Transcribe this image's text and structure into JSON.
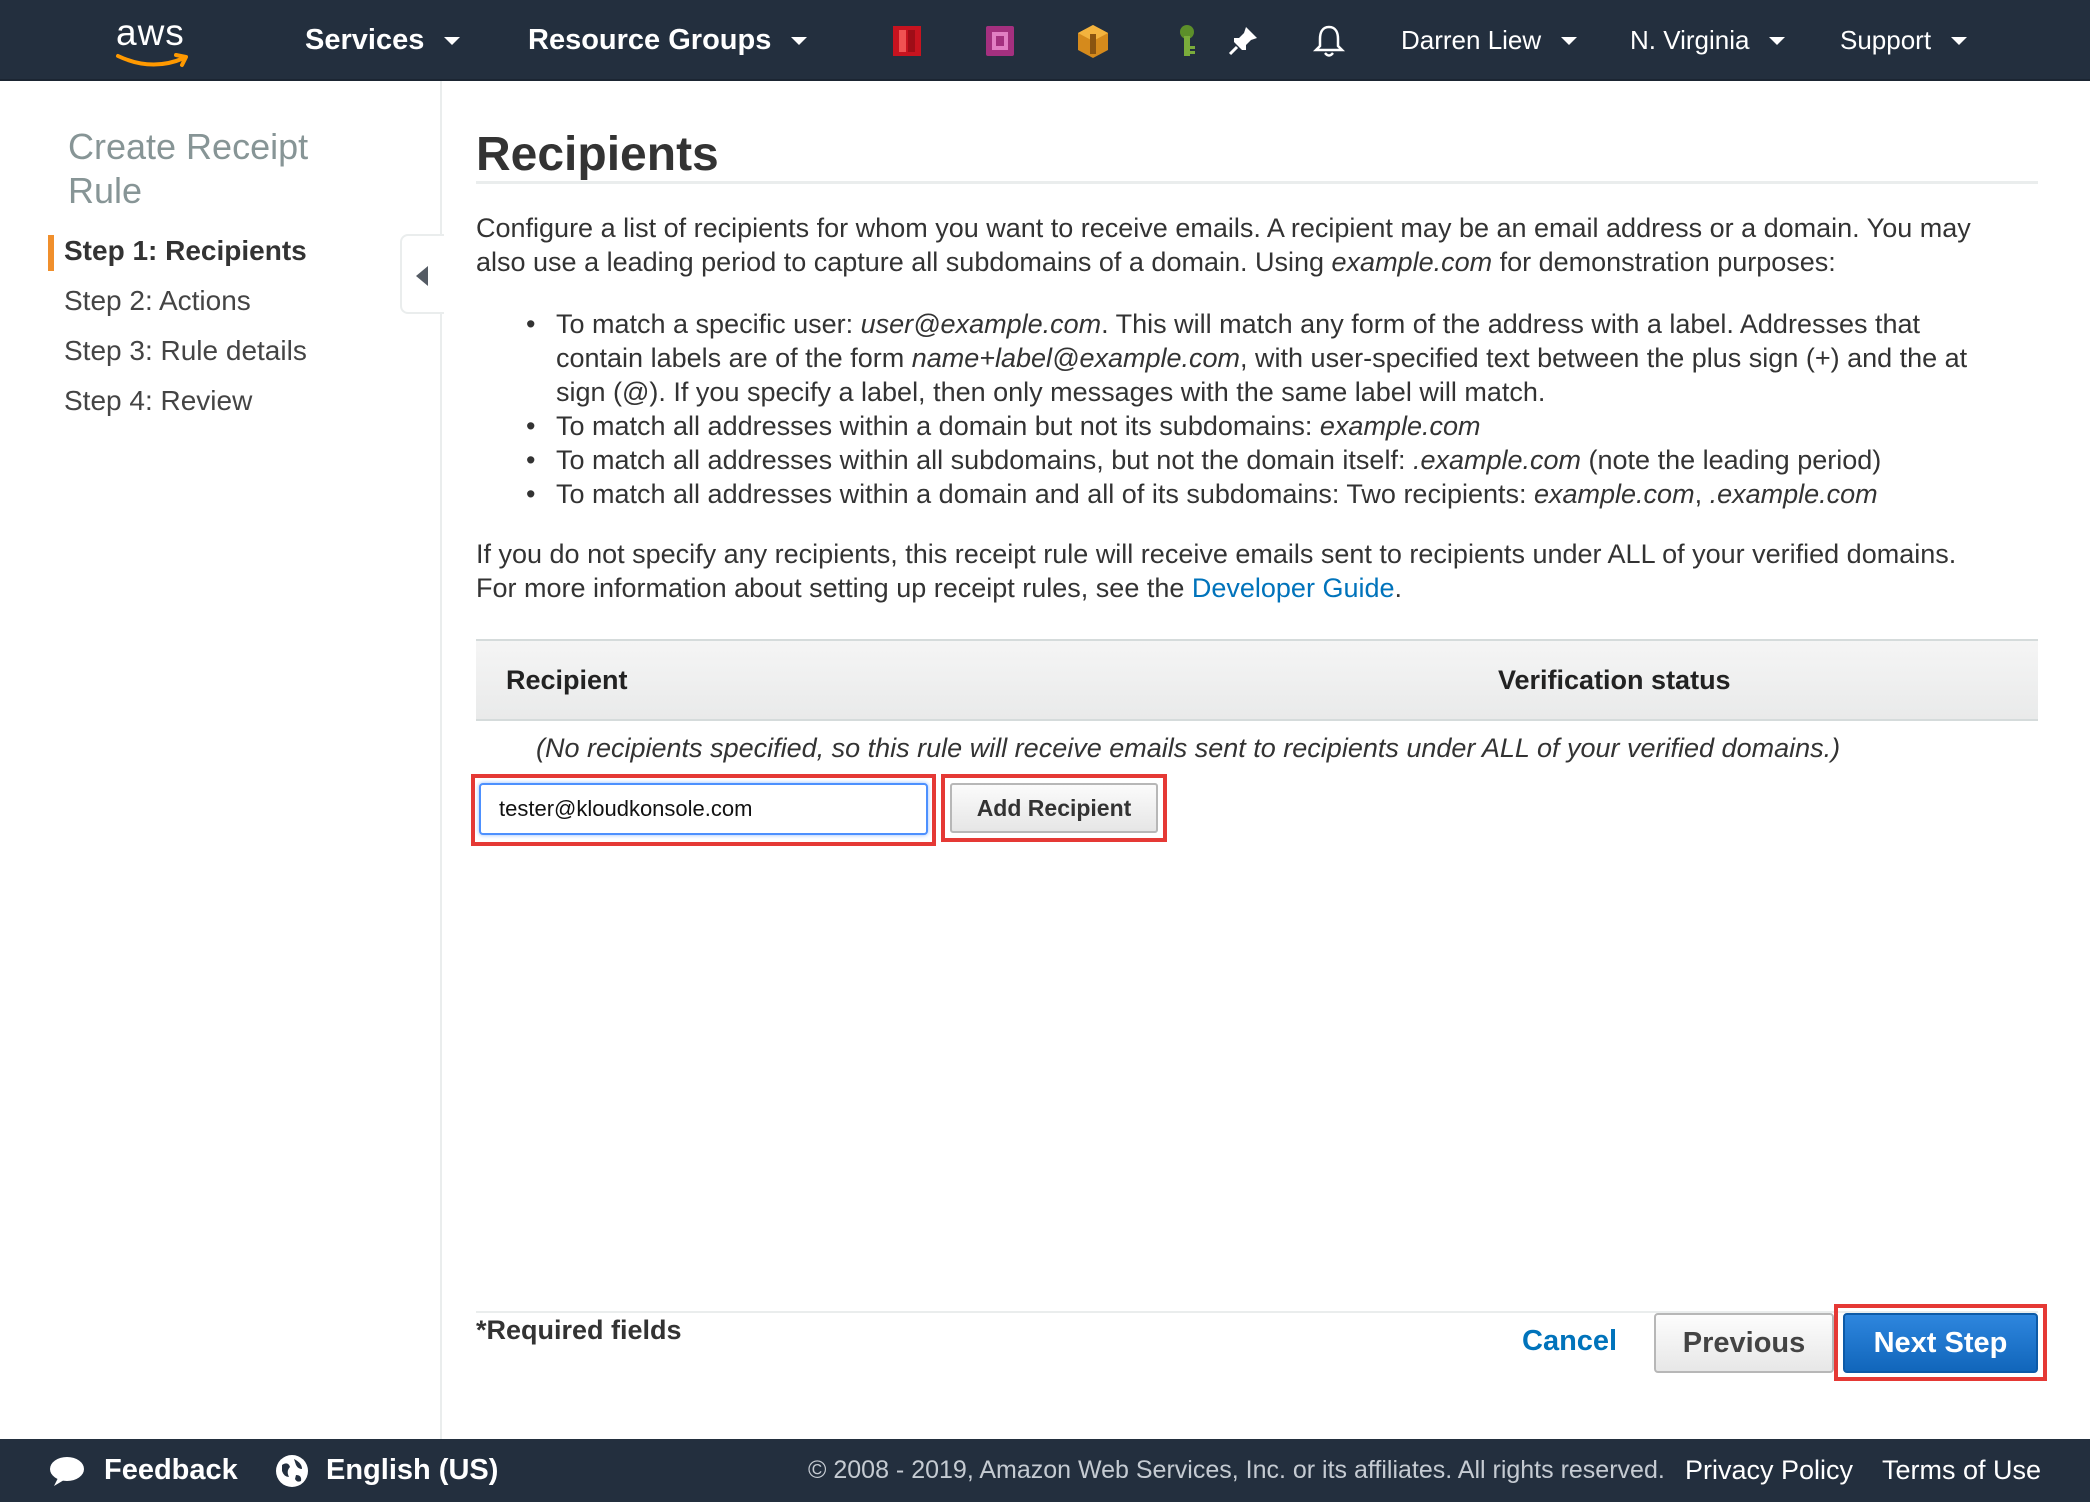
{
  "topnav": {
    "logo_text": "aws",
    "services_label": "Services",
    "resource_groups_label": "Resource Groups",
    "user_label": "Darren Liew",
    "region_label": "N. Virginia",
    "support_label": "Support",
    "service_icons": [
      "red-service-icon",
      "purple-service-icon",
      "orange-service-icon",
      "green-key-icon"
    ],
    "pin_icon": "pin-icon",
    "bell_icon": "bell-icon"
  },
  "sidebar": {
    "title": "Create Receipt Rule",
    "steps": [
      "Step 1: Recipients",
      "Step 2: Actions",
      "Step 3: Rule details",
      "Step 4: Review"
    ],
    "active_step_index": 0
  },
  "main": {
    "heading": "Recipients",
    "intro_1": "Configure a list of recipients for whom you want to receive emails. A recipient may be an email address or a domain. You may",
    "intro_2a": "also use a leading period to capture all subdomains of a domain. Using ",
    "intro_2b": "example.com",
    "intro_2c": " for demonstration purposes:",
    "bullet_1a": "To match a specific user: ",
    "bullet_1b": "user@example.com",
    "bullet_1c": ". This will match any form of the address with a label. Addresses that",
    "bullet_1d": "contain labels are of the form ",
    "bullet_1e": "name+label@example.com",
    "bullet_1f": ", with user-specified text between the plus sign (+) and the at",
    "bullet_1g": "sign (@). If you specify a label, then only messages with the same label will match.",
    "bullet_2a": "To match all addresses within a domain but not its subdomains: ",
    "bullet_2b": "example.com",
    "bullet_3a": "To match all addresses within all subdomains, but not the domain itself: ",
    "bullet_3b": ".example.com",
    "bullet_3c": " (note the leading period)",
    "bullet_4a": "To match all addresses within a domain and all of its subdomains: Two recipients: ",
    "bullet_4b": "example.com",
    "bullet_4c": ", ",
    "bullet_4d": ".example.com",
    "note_1": "If you do not specify any recipients, this receipt rule will receive emails sent to recipients under ALL of your verified domains.",
    "note_2a": "For more information about setting up receipt rules, see the ",
    "note_2_link": "Developer Guide",
    "note_2b": ".",
    "table": {
      "col_recipient": "Recipient",
      "col_status": "Verification status",
      "empty_text": "(No recipients specified, so this rule will receive emails sent to recipients under ALL of your verified domains.)"
    },
    "recipient_input_value": "tester@kloudkonsole.com",
    "add_recipient_label": "Add Recipient",
    "required_label": "*Required fields",
    "cancel_label": "Cancel",
    "previous_label": "Previous",
    "next_label": "Next Step"
  },
  "bottombar": {
    "feedback_label": "Feedback",
    "language_label": "English (US)",
    "copyright": "© 2008 - 2019, Amazon Web Services, Inc. or its affiliates. All rights reserved.",
    "privacy_label": "Privacy Policy",
    "terms_label": "Terms of Use"
  },
  "colors": {
    "nav_bg": "#232f3e",
    "accent_orange": "#f08f2c",
    "link_blue": "#0073bb",
    "primary_button": "#1166bb",
    "highlight_red": "#e53935"
  }
}
